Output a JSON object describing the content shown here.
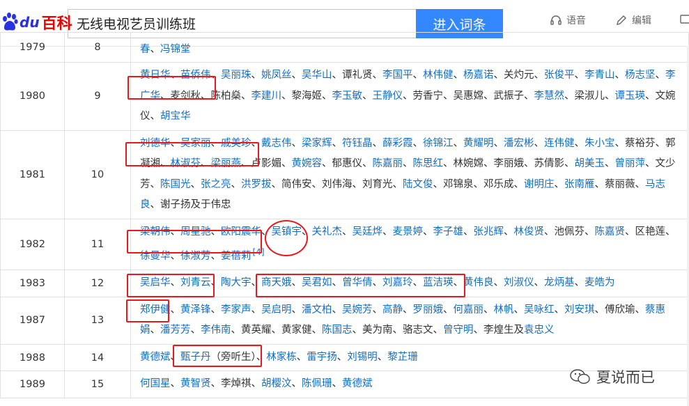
{
  "header": {
    "logo_du": "du",
    "logo_text": "百科",
    "search_value": "无线电视艺员训练班",
    "search_button": "进入词条",
    "voice_label": "语音",
    "edit_label": "编辑"
  },
  "table": {
    "rows": [
      {
        "year": "1979",
        "num": "8",
        "names": [
          {
            "t": "春",
            "l": true
          },
          {
            "t": "、",
            "l": false
          },
          {
            "t": "冯锦堂",
            "l": true
          }
        ]
      },
      {
        "year": "1980",
        "num": "9",
        "names": [
          {
            "t": "黄日华",
            "l": true
          },
          {
            "t": "、",
            "l": false
          },
          {
            "t": "苗侨伟",
            "l": true
          },
          {
            "t": "、",
            "l": false
          },
          {
            "t": "吴丽珠",
            "l": true
          },
          {
            "t": "、",
            "l": false
          },
          {
            "t": "姚凤丝",
            "l": true
          },
          {
            "t": "、",
            "l": false
          },
          {
            "t": "吴华山",
            "l": true
          },
          {
            "t": "、谭礼贤、",
            "l": false
          },
          {
            "t": "李国平",
            "l": true
          },
          {
            "t": "、",
            "l": false
          },
          {
            "t": "林伟健",
            "l": true
          },
          {
            "t": "、",
            "l": false
          },
          {
            "t": "杨嘉诺",
            "l": true
          },
          {
            "t": "、关灼元、",
            "l": false
          },
          {
            "t": "张俊平",
            "l": true
          },
          {
            "t": "、",
            "l": false
          },
          {
            "t": "李青山",
            "l": true
          },
          {
            "t": "、",
            "l": false
          },
          {
            "t": "杨志坚",
            "l": true
          },
          {
            "t": "、",
            "l": false
          },
          {
            "t": "李广华",
            "l": true
          },
          {
            "t": "、麦剑秋、陈柏燊、",
            "l": false
          },
          {
            "t": "李建川",
            "l": true
          },
          {
            "t": "、黎海姬、",
            "l": false
          },
          {
            "t": "李玉敏",
            "l": true
          },
          {
            "t": "、",
            "l": false
          },
          {
            "t": "王静仪",
            "l": true
          },
          {
            "t": "、劳香宁、吴惠嫦、武振子、",
            "l": false
          },
          {
            "t": "李慧然",
            "l": true
          },
          {
            "t": "、梁淑儿、",
            "l": false
          },
          {
            "t": "谭玉瑛",
            "l": true
          },
          {
            "t": "、文婉仪、",
            "l": false
          },
          {
            "t": "胡宝华",
            "l": true
          }
        ]
      },
      {
        "year": "1981",
        "num": "10",
        "names": [
          {
            "t": "刘德华",
            "l": true
          },
          {
            "t": "、",
            "l": false
          },
          {
            "t": "吴家丽",
            "l": true
          },
          {
            "t": "、",
            "l": false
          },
          {
            "t": "戚美珍",
            "l": true
          },
          {
            "t": "、",
            "l": false
          },
          {
            "t": "戴志伟",
            "l": true
          },
          {
            "t": "、",
            "l": false
          },
          {
            "t": "梁家辉",
            "l": true
          },
          {
            "t": "、",
            "l": false
          },
          {
            "t": "符钰晶",
            "l": true
          },
          {
            "t": "、",
            "l": false
          },
          {
            "t": "薛彩霞",
            "l": true
          },
          {
            "t": "、",
            "l": false
          },
          {
            "t": "徐锦江",
            "l": true
          },
          {
            "t": "、",
            "l": false
          },
          {
            "t": "黄耀明",
            "l": true
          },
          {
            "t": "、",
            "l": false
          },
          {
            "t": "潘宏彬",
            "l": true
          },
          {
            "t": "、",
            "l": false
          },
          {
            "t": "连伟健",
            "l": true
          },
          {
            "t": "、",
            "l": false
          },
          {
            "t": "朱小宝",
            "l": true
          },
          {
            "t": "、蔡裕芬、郭凝湘、",
            "l": false
          },
          {
            "t": "林淑芬",
            "l": true
          },
          {
            "t": "、",
            "l": false
          },
          {
            "t": "梁丽燕",
            "l": true
          },
          {
            "t": "、卢影媚、",
            "l": false
          },
          {
            "t": "黄婉容",
            "l": true
          },
          {
            "t": "、郁惠仪、",
            "l": false
          },
          {
            "t": "陈嘉丽",
            "l": true
          },
          {
            "t": "、",
            "l": false
          },
          {
            "t": "陈思红",
            "l": true
          },
          {
            "t": "、林婉嫦、李丽娥、苏倩影、",
            "l": false
          },
          {
            "t": "胡美玉",
            "l": true
          },
          {
            "t": "、",
            "l": false
          },
          {
            "t": "曾丽萍",
            "l": true
          },
          {
            "t": "、文少芳、",
            "l": false
          },
          {
            "t": "陈国光",
            "l": true
          },
          {
            "t": "、",
            "l": false
          },
          {
            "t": "张之亮",
            "l": true
          },
          {
            "t": "、",
            "l": false
          },
          {
            "t": "洪罗拔",
            "l": true
          },
          {
            "t": "、简伟安、刘伟海、刘育光、",
            "l": false
          },
          {
            "t": "陆文俊",
            "l": true
          },
          {
            "t": "、邓锦泉、邓乐成、",
            "l": false
          },
          {
            "t": "谢明庄",
            "l": true
          },
          {
            "t": "、",
            "l": false
          },
          {
            "t": "张南雁",
            "l": true
          },
          {
            "t": "、蔡丽薇、",
            "l": false
          },
          {
            "t": "马志良",
            "l": true
          },
          {
            "t": "、谢子扬及于伟忠",
            "l": false
          }
        ]
      },
      {
        "year": "1982",
        "num": "11",
        "names": [
          {
            "t": "梁朝伟",
            "l": true
          },
          {
            "t": "、",
            "l": false
          },
          {
            "t": "周星驰",
            "l": true
          },
          {
            "t": "、",
            "l": false
          },
          {
            "t": "欧阳震华",
            "l": true
          },
          {
            "t": "、",
            "l": false
          },
          {
            "t": "吴镇宇",
            "l": true
          },
          {
            "t": "、",
            "l": false
          },
          {
            "t": "关礼杰",
            "l": true
          },
          {
            "t": "、",
            "l": false
          },
          {
            "t": "吴廷烨",
            "l": true
          },
          {
            "t": "、",
            "l": false
          },
          {
            "t": "麦景婷",
            "l": true
          },
          {
            "t": "、",
            "l": false
          },
          {
            "t": "李子雄",
            "l": true
          },
          {
            "t": "、",
            "l": false
          },
          {
            "t": "张兆辉",
            "l": true
          },
          {
            "t": "、",
            "l": false
          },
          {
            "t": "林俊贤",
            "l": true
          },
          {
            "t": "、池佩芬、",
            "l": false
          },
          {
            "t": "陈嘉贤",
            "l": true
          },
          {
            "t": "、区艳莲、",
            "l": false
          },
          {
            "t": "徐曼华",
            "l": true
          },
          {
            "t": "、",
            "l": false
          },
          {
            "t": "徐淑芳",
            "l": true
          },
          {
            "t": "、",
            "l": false
          },
          {
            "t": "姜蓓莉",
            "l": true
          }
        ],
        "sup": "[4]"
      },
      {
        "year": "1983",
        "num": "12",
        "names": [
          {
            "t": "吴启华",
            "l": true
          },
          {
            "t": "、",
            "l": false
          },
          {
            "t": "刘青云",
            "l": true
          },
          {
            "t": "、",
            "l": false
          },
          {
            "t": "陶大宇",
            "l": true
          },
          {
            "t": "、",
            "l": false
          },
          {
            "t": "商天娥",
            "l": true
          },
          {
            "t": "、",
            "l": false
          },
          {
            "t": "吴君如",
            "l": true
          },
          {
            "t": "、",
            "l": false
          },
          {
            "t": "曾华倩",
            "l": true
          },
          {
            "t": "、",
            "l": false
          },
          {
            "t": "刘嘉玲",
            "l": true
          },
          {
            "t": "、",
            "l": false
          },
          {
            "t": "蓝洁瑛",
            "l": true
          },
          {
            "t": "、",
            "l": false
          },
          {
            "t": "黄伟良",
            "l": true
          },
          {
            "t": "、",
            "l": false
          },
          {
            "t": "刘淑仪",
            "l": true
          },
          {
            "t": "、",
            "l": false
          },
          {
            "t": "龙炳基",
            "l": true
          },
          {
            "t": "、",
            "l": false
          },
          {
            "t": "麦皓为",
            "l": true
          }
        ]
      },
      {
        "year": "1987",
        "num": "13",
        "names": [
          {
            "t": "郑伊健",
            "l": true
          },
          {
            "t": "、",
            "l": false
          },
          {
            "t": "黄泽锋",
            "l": true
          },
          {
            "t": "、",
            "l": false
          },
          {
            "t": "李家声",
            "l": true
          },
          {
            "t": "、",
            "l": false
          },
          {
            "t": "吴启明",
            "l": true
          },
          {
            "t": "、",
            "l": false
          },
          {
            "t": "潘文柏",
            "l": true
          },
          {
            "t": "、",
            "l": false
          },
          {
            "t": "吴婉芳",
            "l": true
          },
          {
            "t": "、",
            "l": false
          },
          {
            "t": "高静",
            "l": true
          },
          {
            "t": "、",
            "l": false
          },
          {
            "t": "罗丽娥",
            "l": true
          },
          {
            "t": "、",
            "l": false
          },
          {
            "t": "何嘉丽",
            "l": true
          },
          {
            "t": "、",
            "l": false
          },
          {
            "t": "林帆",
            "l": true
          },
          {
            "t": "、",
            "l": false
          },
          {
            "t": "吴咏红",
            "l": true
          },
          {
            "t": "、",
            "l": false
          },
          {
            "t": "刘安琪",
            "l": true
          },
          {
            "t": "、傅欣瑜、",
            "l": false
          },
          {
            "t": "蔡惠娟",
            "l": true
          },
          {
            "t": "、",
            "l": false
          },
          {
            "t": "潘芳芳",
            "l": true
          },
          {
            "t": "、",
            "l": false
          },
          {
            "t": "李伟南",
            "l": true
          },
          {
            "t": "、黄英耀、黄家健、",
            "l": false
          },
          {
            "t": "陈国志",
            "l": true
          },
          {
            "t": "、美为南、骆志文、",
            "l": false
          },
          {
            "t": "曾守明",
            "l": true
          },
          {
            "t": "、李煌生及",
            "l": false
          },
          {
            "t": "袁忠义",
            "l": true
          }
        ]
      },
      {
        "year": "1988",
        "num": "14",
        "names": [
          {
            "t": "黄德斌",
            "l": true
          },
          {
            "t": "、",
            "l": false
          },
          {
            "t": "甄子丹",
            "l": true
          },
          {
            "t": "（旁听生）",
            "l": false
          },
          {
            "t": "、",
            "l": false
          },
          {
            "t": "林家栋",
            "l": true
          },
          {
            "t": "、",
            "l": false
          },
          {
            "t": "雷宇扬",
            "l": true
          },
          {
            "t": "、",
            "l": false
          },
          {
            "t": "刘锡明",
            "l": true
          },
          {
            "t": "、",
            "l": false
          },
          {
            "t": "黎芷珊",
            "l": true
          }
        ]
      },
      {
        "year": "1989",
        "num": "15",
        "names": [
          {
            "t": "何国星",
            "l": true
          },
          {
            "t": "、",
            "l": false
          },
          {
            "t": "黄智贤",
            "l": true
          },
          {
            "t": "、李焯祺、",
            "l": false
          },
          {
            "t": "胡樱汶",
            "l": true
          },
          {
            "t": "、",
            "l": false
          },
          {
            "t": "陈佩珊",
            "l": true
          },
          {
            "t": "、",
            "l": false
          },
          {
            "t": "黄德斌",
            "l": true
          }
        ]
      }
    ]
  },
  "watermark": {
    "text": "夏说而已"
  },
  "colors": {
    "link": "#136ec2",
    "accent": "#3388ff",
    "highlight": "#e8181d"
  }
}
